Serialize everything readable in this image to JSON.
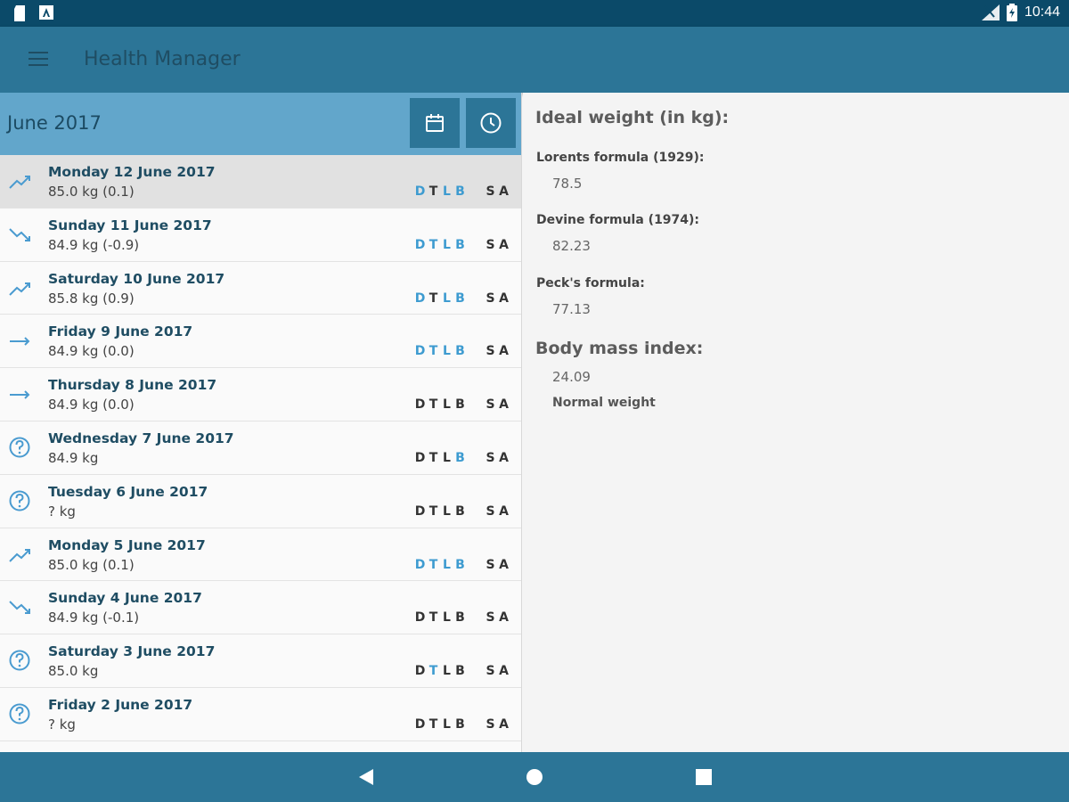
{
  "status_bar": {
    "time": "10:44"
  },
  "app_bar": {
    "title": "Health Manager"
  },
  "list": {
    "month": "June 2017",
    "rows": [
      {
        "date": "Monday 12 June 2017",
        "weight": "85.0 kg (0.1)",
        "trend": "trending-up",
        "selected": true,
        "meals": [
          [
            "D",
            "blue"
          ],
          [
            "T",
            "dark"
          ],
          [
            "L",
            "blue"
          ],
          [
            "B",
            "blue"
          ],
          [
            "S",
            "dark"
          ],
          [
            "A",
            "dark"
          ]
        ]
      },
      {
        "date": "Sunday 11 June 2017",
        "weight": "84.9 kg (-0.9)",
        "trend": "trending-down",
        "meals": [
          [
            "D",
            "blue"
          ],
          [
            "T",
            "blue"
          ],
          [
            "L",
            "blue"
          ],
          [
            "B",
            "blue"
          ],
          [
            "S",
            "dark"
          ],
          [
            "A",
            "dark"
          ]
        ]
      },
      {
        "date": "Saturday 10 June 2017",
        "weight": "85.8 kg (0.9)",
        "trend": "trending-up",
        "meals": [
          [
            "D",
            "blue"
          ],
          [
            "T",
            "dark"
          ],
          [
            "L",
            "blue"
          ],
          [
            "B",
            "blue"
          ],
          [
            "S",
            "dark"
          ],
          [
            "A",
            "dark"
          ]
        ]
      },
      {
        "date": "Friday 9 June 2017",
        "weight": "84.9 kg (0.0)",
        "trend": "trending-flat",
        "meals": [
          [
            "D",
            "blue"
          ],
          [
            "T",
            "blue"
          ],
          [
            "L",
            "blue"
          ],
          [
            "B",
            "blue"
          ],
          [
            "S",
            "dark"
          ],
          [
            "A",
            "dark"
          ]
        ]
      },
      {
        "date": "Thursday 8 June 2017",
        "weight": "84.9 kg (0.0)",
        "trend": "trending-flat",
        "meals": [
          [
            "D",
            "dark"
          ],
          [
            "T",
            "dark"
          ],
          [
            "L",
            "dark"
          ],
          [
            "B",
            "dark"
          ],
          [
            "S",
            "dark"
          ],
          [
            "A",
            "dark"
          ]
        ]
      },
      {
        "date": "Wednesday 7 June 2017",
        "weight": "84.9 kg",
        "trend": "help-circle",
        "meals": [
          [
            "D",
            "dark"
          ],
          [
            "T",
            "dark"
          ],
          [
            "L",
            "dark"
          ],
          [
            "B",
            "blue"
          ],
          [
            "S",
            "dark"
          ],
          [
            "A",
            "dark"
          ]
        ]
      },
      {
        "date": "Tuesday 6 June 2017",
        "weight": "? kg",
        "trend": "help-circle",
        "meals": [
          [
            "D",
            "dark"
          ],
          [
            "T",
            "dark"
          ],
          [
            "L",
            "dark"
          ],
          [
            "B",
            "dark"
          ],
          [
            "S",
            "dark"
          ],
          [
            "A",
            "dark"
          ]
        ]
      },
      {
        "date": "Monday 5 June 2017",
        "weight": "85.0 kg (0.1)",
        "trend": "trending-up",
        "meals": [
          [
            "D",
            "blue"
          ],
          [
            "T",
            "blue"
          ],
          [
            "L",
            "blue"
          ],
          [
            "B",
            "blue"
          ],
          [
            "S",
            "dark"
          ],
          [
            "A",
            "dark"
          ]
        ]
      },
      {
        "date": "Sunday 4 June 2017",
        "weight": "84.9 kg (-0.1)",
        "trend": "trending-down",
        "meals": [
          [
            "D",
            "dark"
          ],
          [
            "T",
            "dark"
          ],
          [
            "L",
            "dark"
          ],
          [
            "B",
            "dark"
          ],
          [
            "S",
            "dark"
          ],
          [
            "A",
            "dark"
          ]
        ]
      },
      {
        "date": "Saturday 3 June 2017",
        "weight": "85.0 kg",
        "trend": "help-circle",
        "meals": [
          [
            "D",
            "dark"
          ],
          [
            "T",
            "blue"
          ],
          [
            "L",
            "dark"
          ],
          [
            "B",
            "dark"
          ],
          [
            "S",
            "dark"
          ],
          [
            "A",
            "dark"
          ]
        ]
      },
      {
        "date": "Friday 2 June 2017",
        "weight": "? kg",
        "trend": "help-circle",
        "meals": [
          [
            "D",
            "dark"
          ],
          [
            "T",
            "dark"
          ],
          [
            "L",
            "dark"
          ],
          [
            "B",
            "dark"
          ],
          [
            "S",
            "dark"
          ],
          [
            "A",
            "dark"
          ]
        ]
      }
    ]
  },
  "detail": {
    "ideal_heading": "Ideal weight (in kg):",
    "lorents_label": "Lorents formula (1929):",
    "lorents_value": "78.5",
    "devine_label": "Devine formula (1974):",
    "devine_value": "82.23",
    "peck_label": "Peck's formula:",
    "peck_value": "77.13",
    "bmi_heading": "Body mass index:",
    "bmi_value": "24.09",
    "bmi_category": "Normal weight"
  },
  "colors": {
    "status_bar": "#0b4a69",
    "app_bar": "#2c7597",
    "month_header": "#62a6cb",
    "meal_active": "#3d9bd0",
    "meal_inactive": "#333333"
  }
}
